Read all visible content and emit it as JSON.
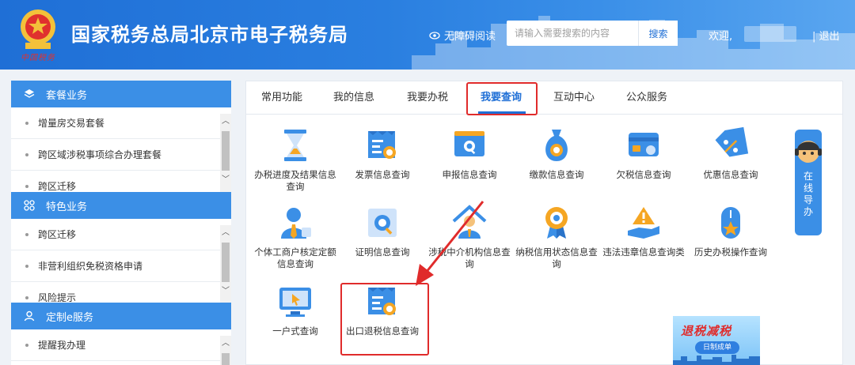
{
  "header": {
    "emblem_sign": "中国税务",
    "title": "国家税务总局北京市电子税务局",
    "accessibility_label": "无障碍阅读",
    "search_placeholder": "请输入需要搜索的内容",
    "search_button": "搜索",
    "welcome": "欢迎,",
    "logout": "| 退出"
  },
  "sidebar": {
    "sections": [
      {
        "title": "套餐业务",
        "icon": "layers-icon",
        "items": [
          "增量房交易套餐",
          "跨区域涉税事项综合办理套餐",
          "跨区迁移"
        ]
      },
      {
        "title": "特色业务",
        "icon": "grid-icon",
        "items": [
          "跨区迁移",
          "非营利组织免税资格申请",
          "风险提示"
        ]
      },
      {
        "title": "定制e服务",
        "icon": "user-icon",
        "items": [
          "提醒我办理"
        ]
      }
    ]
  },
  "tabs": [
    {
      "label": "常用功能",
      "active": false
    },
    {
      "label": "我的信息",
      "active": false
    },
    {
      "label": "我要办税",
      "active": false
    },
    {
      "label": "我要查询",
      "active": true
    },
    {
      "label": "互动中心",
      "active": false
    },
    {
      "label": "公众服务",
      "active": false
    }
  ],
  "tiles": [
    {
      "label": "办税进度及结果信息查询",
      "icon": "hourglass-icon"
    },
    {
      "label": "发票信息查询",
      "icon": "invoice-search-icon"
    },
    {
      "label": "申报信息查询",
      "icon": "monitor-search-icon"
    },
    {
      "label": "缴款信息查询",
      "icon": "money-bag-icon"
    },
    {
      "label": "欠税信息查询",
      "icon": "card-icon"
    },
    {
      "label": "优惠信息查询",
      "icon": "discount-tag-icon"
    },
    {
      "label": "个体工商户核定定额信息查询",
      "icon": "person-icon"
    },
    {
      "label": "证明信息查询",
      "icon": "certificate-search-icon"
    },
    {
      "label": "涉税中介机构信息查询",
      "icon": "agency-icon"
    },
    {
      "label": "纳税信用状态信息查询",
      "icon": "medal-icon"
    },
    {
      "label": "违法违章信息查询类",
      "icon": "warning-hand-icon"
    },
    {
      "label": "历史办税操作查询",
      "icon": "mouse-star-icon"
    },
    {
      "label": "一户式查询",
      "icon": "computer-cursor-icon"
    },
    {
      "label": "出口退税信息查询",
      "icon": "invoice-search-icon"
    }
  ],
  "guide": {
    "label": "在线导办"
  },
  "promo": {
    "title": "退税减税",
    "subtitle": "日制成单"
  },
  "colors": {
    "brand_blue": "#1f6fd6",
    "highlight_red": "#e02b2b",
    "sidebar_blue": "#3b8fe6"
  }
}
